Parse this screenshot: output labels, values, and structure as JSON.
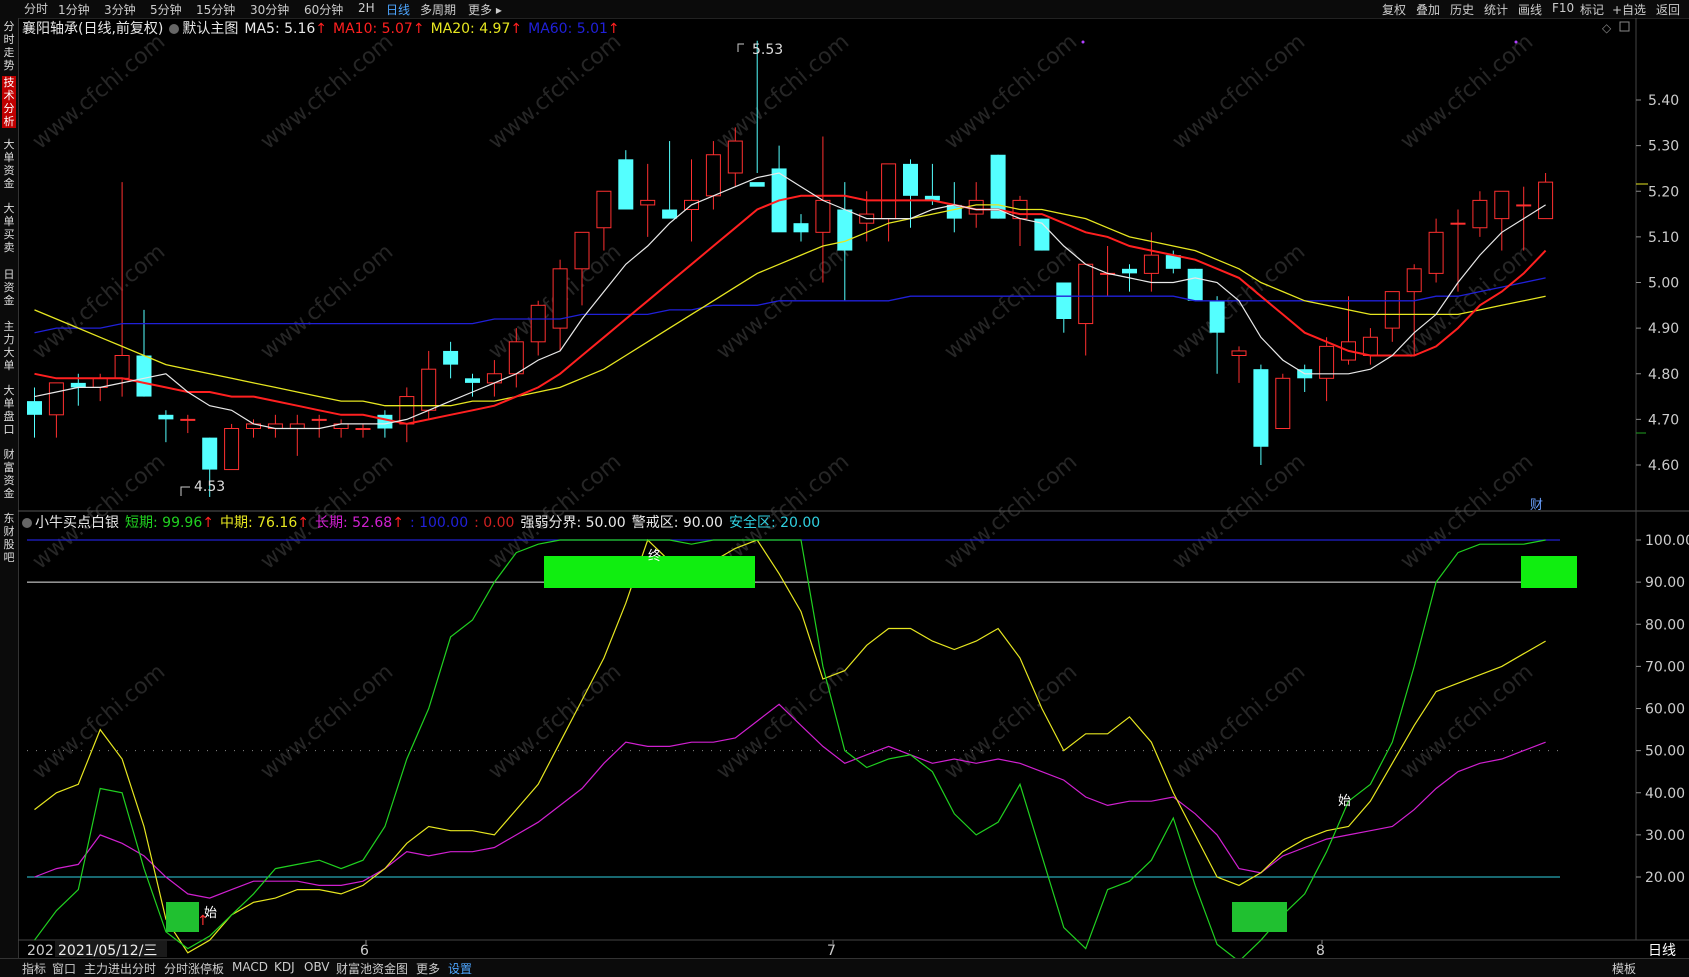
{
  "toolbar": {
    "periods": [
      "分时",
      "1分钟",
      "3分钟",
      "5分钟",
      "15分钟",
      "30分钟",
      "60分钟",
      "2H",
      "日线",
      "多周期",
      "更多 ▸"
    ],
    "active_period": "日线",
    "right": [
      "复权",
      "叠加",
      "历史",
      "统计",
      "画线",
      "F10",
      "标记",
      "+自选",
      "返回"
    ]
  },
  "sidebar": {
    "tabs": [
      "分时走势",
      "技术分析",
      "大单资金",
      "大单买卖",
      "日资金",
      "主力大单",
      "大单盘口",
      "财富资金",
      "东财股吧"
    ],
    "active": "技术分析"
  },
  "main_legend": {
    "stock": "襄阳轴承(日线,前复权)",
    "template": "默认主图",
    "ma5": "MA5: 5.16",
    "ma10": "MA10: 5.07",
    "ma20": "MA20: 4.97",
    "ma60": "MA60: 5.01",
    "arrow": "↑",
    "colors": {
      "ma5": "#e8e8e8",
      "ma10": "#ff2020",
      "ma20": "#e6e620",
      "ma60": "#2020d8"
    }
  },
  "indicator_legend": {
    "name": "小牛买点白银",
    "short": "短期: 99.96",
    "mid": "中期: 76.16",
    "long": "长期: 52.68",
    "arrow": "↑",
    "extra1": ": 100.00",
    "extra2": ": 0.00",
    "strong_weak": "强弱分界: 50.00",
    "alert": "警戒区: 90.00",
    "safe": "安全区: 20.00"
  },
  "annotations": {
    "high": "5.53",
    "low": "4.53",
    "cai": "财",
    "start": "始",
    "end": "终"
  },
  "date_axis": {
    "first": "202",
    "cursor": "2021/05/12/三",
    "months": [
      "6",
      "7",
      "8"
    ],
    "period_label": "日线"
  },
  "bottom_tabs": [
    "指标",
    "窗口",
    "主力进出分时",
    "分时涨停板",
    "MACD",
    "KDJ",
    "OBV",
    "财富池资金图",
    "更多",
    "设置"
  ],
  "bottom_right": "模板",
  "watermark": "www.cfchi.com",
  "chart_data": [
    {
      "type": "candlestick",
      "title": "襄阳轴承(日线,前复权)",
      "y_ticks": [
        5.4,
        5.3,
        5.2,
        5.1,
        5.0,
        4.9,
        4.8,
        4.7,
        4.6
      ],
      "ylim": [
        4.49,
        5.62
      ],
      "candles": [
        [
          4.74,
          4.77,
          4.66,
          4.71
        ],
        [
          4.71,
          4.78,
          4.66,
          4.78
        ],
        [
          4.78,
          4.8,
          4.73,
          4.77
        ],
        [
          4.77,
          4.8,
          4.74,
          4.79
        ],
        [
          4.79,
          5.22,
          4.75,
          4.84
        ],
        [
          4.84,
          4.94,
          4.75,
          4.75
        ],
        [
          4.71,
          4.72,
          4.65,
          4.7
        ],
        [
          4.7,
          4.71,
          4.67,
          4.7
        ],
        [
          4.66,
          4.66,
          4.53,
          4.59
        ],
        [
          4.59,
          4.69,
          4.59,
          4.68
        ],
        [
          4.68,
          4.7,
          4.66,
          4.69
        ],
        [
          4.68,
          4.71,
          4.66,
          4.69
        ],
        [
          4.68,
          4.71,
          4.62,
          4.69
        ],
        [
          4.7,
          4.71,
          4.66,
          4.7
        ],
        [
          4.68,
          4.7,
          4.66,
          4.69
        ],
        [
          4.68,
          4.69,
          4.66,
          4.68
        ],
        [
          4.71,
          4.72,
          4.66,
          4.68
        ],
        [
          4.69,
          4.77,
          4.65,
          4.75
        ],
        [
          4.72,
          4.85,
          4.7,
          4.81
        ],
        [
          4.85,
          4.87,
          4.79,
          4.82
        ],
        [
          4.79,
          4.8,
          4.75,
          4.78
        ],
        [
          4.78,
          4.83,
          4.75,
          4.8
        ],
        [
          4.8,
          4.9,
          4.77,
          4.87
        ],
        [
          4.87,
          4.96,
          4.84,
          4.95
        ],
        [
          4.9,
          5.05,
          4.85,
          5.03
        ],
        [
          5.03,
          5.1,
          4.95,
          5.11
        ],
        [
          5.12,
          5.18,
          5.07,
          5.2
        ],
        [
          5.27,
          5.29,
          5.21,
          5.16
        ],
        [
          5.17,
          5.26,
          5.1,
          5.18
        ],
        [
          5.16,
          5.31,
          5.15,
          5.14
        ],
        [
          5.16,
          5.27,
          5.09,
          5.18
        ],
        [
          5.19,
          5.31,
          5.16,
          5.28
        ],
        [
          5.24,
          5.34,
          5.21,
          5.31
        ],
        [
          5.22,
          5.53,
          5.24,
          5.21
        ],
        [
          5.25,
          5.3,
          5.13,
          5.11
        ],
        [
          5.13,
          5.15,
          5.09,
          5.11
        ],
        [
          5.11,
          5.32,
          5.0,
          5.18
        ],
        [
          5.16,
          5.22,
          4.96,
          5.07
        ],
        [
          5.13,
          5.2,
          5.09,
          5.15
        ],
        [
          5.14,
          5.26,
          5.09,
          5.26
        ],
        [
          5.26,
          5.27,
          5.12,
          5.19
        ],
        [
          5.19,
          5.26,
          5.17,
          5.18
        ],
        [
          5.17,
          5.22,
          5.11,
          5.14
        ],
        [
          5.15,
          5.22,
          5.12,
          5.18
        ],
        [
          5.28,
          5.28,
          5.14,
          5.14
        ],
        [
          5.14,
          5.19,
          5.08,
          5.18
        ],
        [
          5.14,
          5.14,
          5.07,
          5.07
        ],
        [
          5.0,
          5.0,
          4.89,
          4.92
        ],
        [
          4.91,
          5.04,
          4.84,
          5.04
        ],
        [
          5.02,
          5.08,
          4.97,
          5.02
        ],
        [
          5.03,
          5.04,
          4.98,
          5.02
        ],
        [
          5.02,
          5.11,
          4.98,
          5.06
        ],
        [
          5.06,
          5.07,
          5.02,
          5.03
        ],
        [
          5.03,
          5.03,
          4.96,
          4.96
        ],
        [
          4.96,
          4.97,
          4.8,
          4.89
        ],
        [
          4.84,
          4.86,
          4.78,
          4.85
        ],
        [
          4.81,
          4.82,
          4.6,
          4.64
        ],
        [
          4.68,
          4.8,
          4.68,
          4.79
        ],
        [
          4.81,
          4.82,
          4.76,
          4.79
        ],
        [
          4.79,
          4.88,
          4.74,
          4.86
        ],
        [
          4.83,
          4.97,
          4.82,
          4.87
        ],
        [
          4.84,
          4.9,
          4.82,
          4.88
        ],
        [
          4.9,
          4.96,
          4.87,
          4.98
        ],
        [
          4.98,
          5.04,
          4.84,
          5.03
        ],
        [
          5.02,
          5.14,
          5.0,
          5.11
        ],
        [
          5.13,
          5.16,
          4.98,
          5.13
        ],
        [
          5.12,
          5.2,
          5.1,
          5.18
        ],
        [
          5.14,
          5.18,
          5.07,
          5.2
        ],
        [
          5.17,
          5.21,
          5.07,
          5.17
        ],
        [
          5.14,
          5.24,
          5.15,
          5.22
        ]
      ],
      "ma5": [
        4.75,
        4.76,
        4.77,
        4.77,
        4.78,
        4.79,
        4.8,
        4.76,
        4.73,
        4.72,
        4.69,
        4.68,
        4.68,
        4.68,
        4.69,
        4.69,
        4.69,
        4.7,
        4.72,
        4.74,
        4.76,
        4.78,
        4.8,
        4.83,
        4.85,
        4.92,
        4.98,
        5.04,
        5.08,
        5.13,
        5.17,
        5.19,
        5.21,
        5.23,
        5.24,
        5.21,
        5.18,
        5.16,
        5.14,
        5.14,
        5.14,
        5.16,
        5.17,
        5.16,
        5.16,
        5.14,
        5.13,
        5.08,
        5.04,
        5.02,
        5.01,
        5.0,
        5.0,
        5.01,
        5.0,
        4.96,
        4.88,
        4.83,
        4.8,
        4.8,
        4.8,
        4.81,
        4.84,
        4.89,
        4.93,
        5.0,
        5.06,
        5.11,
        5.14,
        5.17
      ],
      "ma10": [
        4.8,
        4.79,
        4.79,
        4.79,
        4.79,
        4.78,
        4.77,
        4.76,
        4.76,
        4.75,
        4.75,
        4.74,
        4.73,
        4.72,
        4.71,
        4.71,
        4.7,
        4.69,
        4.7,
        4.71,
        4.72,
        4.73,
        4.75,
        4.77,
        4.8,
        4.84,
        4.88,
        4.92,
        4.96,
        5.0,
        5.04,
        5.08,
        5.12,
        5.16,
        5.18,
        5.19,
        5.19,
        5.19,
        5.18,
        5.18,
        5.18,
        5.18,
        5.17,
        5.16,
        5.16,
        5.15,
        5.15,
        5.13,
        5.11,
        5.1,
        5.08,
        5.07,
        5.06,
        5.05,
        5.03,
        5.01,
        4.97,
        4.93,
        4.89,
        4.87,
        4.85,
        4.84,
        4.84,
        4.84,
        4.86,
        4.9,
        4.95,
        4.98,
        5.02,
        5.07
      ],
      "ma20": [
        4.94,
        4.92,
        4.9,
        4.88,
        4.86,
        4.84,
        4.82,
        4.81,
        4.8,
        4.79,
        4.78,
        4.77,
        4.76,
        4.75,
        4.74,
        4.74,
        4.73,
        4.73,
        4.73,
        4.73,
        4.74,
        4.74,
        4.75,
        4.76,
        4.77,
        4.79,
        4.81,
        4.84,
        4.87,
        4.9,
        4.93,
        4.96,
        4.99,
        5.02,
        5.04,
        5.06,
        5.08,
        5.09,
        5.11,
        5.13,
        5.14,
        5.15,
        5.16,
        5.17,
        5.17,
        5.16,
        5.16,
        5.15,
        5.14,
        5.12,
        5.1,
        5.09,
        5.08,
        5.07,
        5.05,
        5.03,
        5.0,
        4.98,
        4.96,
        4.95,
        4.94,
        4.93,
        4.93,
        4.93,
        4.93,
        4.93,
        4.94,
        4.95,
        4.96,
        4.97
      ],
      "ma60": [
        4.89,
        4.9,
        4.9,
        4.9,
        4.91,
        4.91,
        4.91,
        4.91,
        4.91,
        4.91,
        4.91,
        4.91,
        4.91,
        4.91,
        4.91,
        4.91,
        4.91,
        4.91,
        4.91,
        4.91,
        4.91,
        4.92,
        4.92,
        4.92,
        4.92,
        4.93,
        4.93,
        4.93,
        4.93,
        4.94,
        4.94,
        4.95,
        4.95,
        4.95,
        4.96,
        4.96,
        4.96,
        4.96,
        4.96,
        4.96,
        4.97,
        4.97,
        4.97,
        4.97,
        4.97,
        4.97,
        4.97,
        4.97,
        4.97,
        4.97,
        4.97,
        4.97,
        4.97,
        4.96,
        4.96,
        4.96,
        4.96,
        4.96,
        4.96,
        4.96,
        4.96,
        4.96,
        4.96,
        4.96,
        4.97,
        4.97,
        4.98,
        4.99,
        5.0,
        5.01
      ]
    },
    {
      "type": "line",
      "title": "小牛买点白银",
      "y_ticks": [
        100,
        90,
        80,
        70,
        60,
        50,
        40,
        30,
        20
      ],
      "ylim": [
        -1,
        101
      ],
      "hlines": {
        "blue": 100,
        "white": 90,
        "dotted": 50,
        "cyan": 20,
        "red": 0
      },
      "series": [
        {
          "name": "短期",
          "color": "#20d020",
          "values": [
            5,
            12,
            17,
            41,
            40,
            22,
            7,
            3,
            6,
            11,
            16,
            22,
            23,
            24,
            22,
            24,
            32,
            48,
            60,
            77,
            81,
            90,
            97,
            99,
            100,
            100,
            100,
            100,
            100,
            100,
            99,
            100,
            100,
            100,
            100,
            100,
            70,
            50,
            46,
            48,
            49,
            45,
            35,
            30,
            33,
            42,
            25,
            8,
            3,
            17,
            19,
            24,
            34,
            18,
            4,
            0,
            5,
            11,
            16,
            26,
            38,
            42,
            52,
            70,
            90,
            97,
            99,
            99,
            99,
            100
          ]
        },
        {
          "name": "中期",
          "color": "#e6e620",
          "values": [
            36,
            40,
            42,
            55,
            48,
            32,
            10,
            2,
            5,
            11,
            14,
            15,
            17,
            17,
            16,
            18,
            22,
            28,
            32,
            31,
            31,
            30,
            36,
            42,
            52,
            62,
            72,
            85,
            100,
            95,
            92,
            95,
            98,
            100,
            92,
            83,
            67,
            69,
            75,
            79,
            79,
            76,
            74,
            76,
            79,
            72,
            60,
            50,
            54,
            54,
            58,
            52,
            40,
            30,
            20,
            18,
            21,
            26,
            29,
            31,
            32,
            38,
            47,
            56,
            64,
            66,
            68,
            70,
            73,
            76
          ]
        },
        {
          "name": "长期",
          "color": "#d020d0",
          "values": [
            20,
            22,
            23,
            30,
            28,
            25,
            20,
            16,
            15,
            17,
            19,
            19,
            19,
            18,
            18,
            19,
            22,
            26,
            25,
            26,
            26,
            27,
            30,
            33,
            37,
            41,
            47,
            52,
            51,
            51,
            52,
            52,
            53,
            57,
            61,
            56,
            51,
            47,
            49,
            51,
            49,
            47,
            48,
            47,
            48,
            47,
            45,
            43,
            39,
            37,
            38,
            38,
            39,
            35,
            30,
            22,
            21,
            25,
            27,
            29,
            30,
            31,
            32,
            36,
            41,
            45,
            47,
            48,
            50,
            52
          ]
        }
      ]
    }
  ]
}
